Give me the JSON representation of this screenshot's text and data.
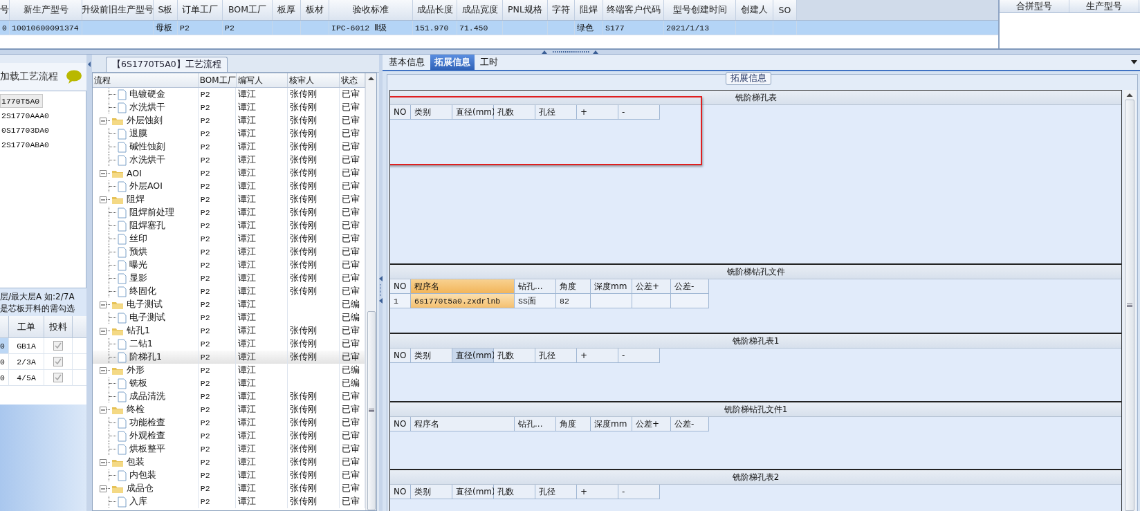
{
  "top_table": {
    "row_selected": true,
    "columns": [
      {
        "label": "号",
        "value": "0"
      },
      {
        "label": "新生产型号",
        "value": "10010600091374"
      },
      {
        "label": "升级前旧生产型号"
      },
      {
        "label": "S板",
        "value": "母板"
      },
      {
        "label": "订单工厂",
        "value": "P2"
      },
      {
        "label": "BOM工厂",
        "value": "P2"
      },
      {
        "label": "板厚"
      },
      {
        "label": "板材"
      },
      {
        "label": "验收标准",
        "value": "IPC-6012 Ⅱ级"
      },
      {
        "label": "成品长度",
        "value": "151.970"
      },
      {
        "label": "成品宽度",
        "value": "71.450"
      },
      {
        "label": "PNL规格"
      },
      {
        "label": "字符"
      },
      {
        "label": "阻焊",
        "value": "绿色"
      },
      {
        "label": "终端客户代码",
        "value": "S177"
      },
      {
        "label": "型号创建时间",
        "value": "2021/1/13"
      },
      {
        "label": "创建人"
      },
      {
        "label": "SO"
      }
    ]
  },
  "merge_table": {
    "columns": [
      "合拼型号",
      "生产型号"
    ]
  },
  "left_panel": {
    "title": "加载工艺流程",
    "items": [
      {
        "label": "1770T5A0",
        "selected": true
      },
      {
        "label": "2S1770AAA0",
        "selected": false
      },
      {
        "label": "0S17703DA0",
        "selected": false
      },
      {
        "label": "2S1770ABA0",
        "selected": false
      }
    ],
    "note": [
      "层/最大层A 如:2/7A",
      "是芯板开料的需勾选"
    ],
    "table": {
      "columns": [
        "工单",
        "投料"
      ],
      "rows": [
        {
          "column_1": "0",
          "order": "GB1A",
          "checked": true,
          "disabled": true,
          "selected": true
        },
        {
          "column_1": "0",
          "order": "2/3A",
          "checked": true,
          "disabled": true,
          "selected": false
        },
        {
          "column_1": "0",
          "order": "4/5A",
          "checked": true,
          "disabled": true,
          "selected": false
        }
      ]
    }
  },
  "process_panel": {
    "title": "【6S1770T5A0】工艺流程",
    "columns": [
      "流程",
      "BOM工厂",
      "编写人",
      "核审人",
      "状态"
    ],
    "tree": [
      {
        "children": [
          {
            "kind": "step",
            "label": "电镀硬金",
            "factory": "P2",
            "writer": "谭江",
            "reviewer": "张传刚",
            "status": "已审",
            "selected": false
          },
          {
            "kind": "step",
            "label": "水洗烘干",
            "factory": "P2",
            "writer": "谭江",
            "reviewer": "张传刚",
            "status": "已审",
            "selected": false
          }
        ]
      },
      {
        "kind": "folder",
        "label": "外层蚀刻",
        "factory": "P2",
        "writer": "谭江",
        "reviewer": "张传刚",
        "status": "已审",
        "selected": false,
        "expanded": true,
        "children": [
          {
            "kind": "step",
            "label": "退膜",
            "factory": "P2",
            "writer": "谭江",
            "reviewer": "张传刚",
            "status": "已审",
            "selected": false
          },
          {
            "kind": "step",
            "label": "碱性蚀刻",
            "factory": "P2",
            "writer": "谭江",
            "reviewer": "张传刚",
            "status": "已审",
            "selected": false
          },
          {
            "kind": "step",
            "label": "水洗烘干",
            "factory": "P2",
            "writer": "谭江",
            "reviewer": "张传刚",
            "status": "已审",
            "selected": false
          }
        ]
      },
      {
        "kind": "folder",
        "label": "AOI",
        "factory": "P2",
        "writer": "谭江",
        "reviewer": "张传刚",
        "status": "已审",
        "selected": false,
        "expanded": true,
        "children": [
          {
            "kind": "step",
            "label": "外层AOI",
            "factory": "P2",
            "writer": "谭江",
            "reviewer": "张传刚",
            "status": "已审",
            "selected": false
          }
        ]
      },
      {
        "kind": "folder",
        "label": "阻焊",
        "factory": "P2",
        "writer": "谭江",
        "reviewer": "张传刚",
        "status": "已审",
        "selected": false,
        "expanded": true,
        "children": [
          {
            "kind": "step",
            "label": "阻焊前处理",
            "factory": "P2",
            "writer": "谭江",
            "reviewer": "张传刚",
            "status": "已审",
            "selected": false
          },
          {
            "kind": "step",
            "label": "阻焊塞孔",
            "factory": "P2",
            "writer": "谭江",
            "reviewer": "张传刚",
            "status": "已审",
            "selected": false
          },
          {
            "kind": "step",
            "label": "丝印",
            "factory": "P2",
            "writer": "谭江",
            "reviewer": "张传刚",
            "status": "已审",
            "selected": false
          },
          {
            "kind": "step",
            "label": "预烘",
            "factory": "P2",
            "writer": "谭江",
            "reviewer": "张传刚",
            "status": "已审",
            "selected": false
          },
          {
            "kind": "step",
            "label": "曝光",
            "factory": "P2",
            "writer": "谭江",
            "reviewer": "张传刚",
            "status": "已审",
            "selected": false
          },
          {
            "kind": "step",
            "label": "显影",
            "factory": "P2",
            "writer": "谭江",
            "reviewer": "张传刚",
            "status": "已审",
            "selected": false
          },
          {
            "kind": "step",
            "label": "终固化",
            "factory": "P2",
            "writer": "谭江",
            "reviewer": "张传刚",
            "status": "已审",
            "selected": false
          }
        ]
      },
      {
        "kind": "folder",
        "label": "电子测试",
        "factory": "P2",
        "writer": "谭江",
        "status": "已编",
        "selected": false,
        "expanded": true,
        "children": [
          {
            "kind": "step",
            "label": "电子测试",
            "factory": "P2",
            "writer": "谭江",
            "status": "已编",
            "selected": false
          }
        ]
      },
      {
        "kind": "folder",
        "label": "钻孔1",
        "factory": "P2",
        "writer": "谭江",
        "reviewer": "张传刚",
        "status": "已审",
        "selected": false,
        "expanded": true,
        "children": [
          {
            "kind": "step",
            "label": "二钻1",
            "factory": "P2",
            "writer": "谭江",
            "reviewer": "张传刚",
            "status": "已审",
            "selected": false
          },
          {
            "kind": "step",
            "label": "阶梯孔1",
            "factory": "P2",
            "writer": "谭江",
            "reviewer": "张传刚",
            "status": "已审",
            "selected": true
          }
        ]
      },
      {
        "kind": "folder",
        "label": "外形",
        "factory": "P2",
        "writer": "谭江",
        "status": "已编",
        "selected": false,
        "expanded": true,
        "children": [
          {
            "kind": "step",
            "label": "铣板",
            "factory": "P2",
            "writer": "谭江",
            "status": "已编",
            "selected": false
          },
          {
            "kind": "step",
            "label": "成品清洗",
            "factory": "P2",
            "writer": "谭江",
            "reviewer": "张传刚",
            "status": "已审",
            "selected": false
          }
        ]
      },
      {
        "kind": "folder",
        "label": "终检",
        "factory": "P2",
        "writer": "谭江",
        "reviewer": "张传刚",
        "status": "已审",
        "selected": false,
        "expanded": true,
        "children": [
          {
            "kind": "step",
            "label": "功能检查",
            "factory": "P2",
            "writer": "谭江",
            "reviewer": "张传刚",
            "status": "已审",
            "selected": false
          },
          {
            "kind": "step",
            "label": "外观检查",
            "factory": "P2",
            "writer": "谭江",
            "reviewer": "张传刚",
            "status": "已审",
            "selected": false
          },
          {
            "kind": "step",
            "label": "烘板整平",
            "factory": "P2",
            "writer": "谭江",
            "reviewer": "张传刚",
            "status": "已审",
            "selected": false
          }
        ]
      },
      {
        "kind": "folder",
        "label": "包装",
        "factory": "P2",
        "writer": "谭江",
        "reviewer": "张传刚",
        "status": "已审",
        "selected": false,
        "expanded": true,
        "children": [
          {
            "kind": "step",
            "label": "内包装",
            "factory": "P2",
            "writer": "谭江",
            "reviewer": "张传刚",
            "status": "已审",
            "selected": false
          }
        ]
      },
      {
        "kind": "folder",
        "label": "成品仓",
        "factory": "P2",
        "writer": "谭江",
        "reviewer": "张传刚",
        "status": "已审",
        "selected": false,
        "expanded": true,
        "children": [
          {
            "kind": "step",
            "label": "入库",
            "factory": "P2",
            "writer": "谭江",
            "reviewer": "张传刚",
            "status": "已审",
            "selected": false
          }
        ]
      }
    ]
  },
  "detail_panel": {
    "tabs": [
      {
        "label": "基本信息",
        "selected": false
      },
      {
        "label": "拓展信息",
        "selected": true
      },
      {
        "label": "工时",
        "selected": false
      }
    ],
    "group_title": "拓展信息",
    "annotation": {
      "kind": "box"
    },
    "sections": [
      {
        "title": "铣阶梯孔表",
        "kind": "holes",
        "columns": [
          {
            "label": "NO",
            "selected": false,
            "hovered": false
          },
          {
            "label": "类别",
            "selected": false,
            "hovered": false
          },
          {
            "label": "直径(mm)",
            "selected": false,
            "hovered": false
          },
          {
            "label": "孔数",
            "selected": false,
            "hovered": false
          },
          {
            "label": "孔径",
            "selected": false,
            "hovered": false
          },
          {
            "label": "+",
            "selected": false,
            "hovered": false
          },
          {
            "label": "-",
            "selected": false,
            "hovered": false
          }
        ]
      },
      {
        "title": "铣阶梯钻孔文件",
        "kind": "files",
        "columns": [
          {
            "label": "NO",
            "selected": false,
            "hovered": false
          },
          {
            "label": "程序名",
            "selected": true,
            "hovered": false
          },
          {
            "label": "钻孔...",
            "selected": false,
            "hovered": false
          },
          {
            "label": "角度",
            "selected": false,
            "hovered": false
          },
          {
            "label": "深度mm",
            "selected": false,
            "hovered": false
          },
          {
            "label": "公差+",
            "selected": false,
            "hovered": false
          },
          {
            "label": "公差-",
            "selected": false,
            "hovered": false
          }
        ],
        "rows": [
          {
            "cells": [
              {
                "text": "1",
                "selected": false
              },
              {
                "text": "6s1770t5a0.zxdrlnb",
                "selected": true
              },
              {
                "text": "SS面",
                "selected": false
              },
              {
                "text": "82",
                "selected": false
              }
            ]
          }
        ]
      },
      {
        "title": "铣阶梯孔表1",
        "kind": "holes",
        "columns": [
          {
            "label": "NO",
            "selected": false,
            "hovered": false
          },
          {
            "label": "类别",
            "selected": false,
            "hovered": false
          },
          {
            "label": "直径(mm)",
            "selected": false,
            "hovered": true
          },
          {
            "label": "孔数",
            "selected": false,
            "hovered": false
          },
          {
            "label": "孔径",
            "selected": false,
            "hovered": false
          },
          {
            "label": "+",
            "selected": false,
            "hovered": false
          },
          {
            "label": "-",
            "selected": false,
            "hovered": false
          }
        ]
      },
      {
        "title": "铣阶梯钻孔文件1",
        "kind": "files",
        "columns": [
          {
            "label": "NO",
            "selected": false,
            "hovered": false
          },
          {
            "label": "程序名",
            "selected": false,
            "hovered": false
          },
          {
            "label": "钻孔...",
            "selected": false,
            "hovered": false
          },
          {
            "label": "角度",
            "selected": false,
            "hovered": false
          },
          {
            "label": "深度mm",
            "selected": false,
            "hovered": false
          },
          {
            "label": "公差+",
            "selected": false,
            "hovered": false
          },
          {
            "label": "公差-",
            "selected": false,
            "hovered": false
          }
        ]
      },
      {
        "title": "铣阶梯孔表2",
        "kind": "holes",
        "columns": [
          {
            "label": "NO",
            "selected": false,
            "hovered": false
          },
          {
            "label": "类别",
            "selected": false,
            "hovered": false
          },
          {
            "label": "直径(mm)",
            "selected": false,
            "hovered": false
          },
          {
            "label": "孔数",
            "selected": false,
            "hovered": false
          },
          {
            "label": "孔径",
            "selected": false,
            "hovered": false
          },
          {
            "label": "+",
            "selected": false,
            "hovered": false
          },
          {
            "label": "-",
            "selected": false,
            "hovered": false
          }
        ]
      }
    ]
  }
}
